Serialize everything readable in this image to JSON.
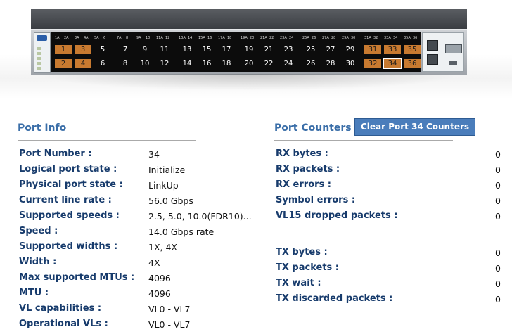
{
  "panel": {
    "port_labels": [
      "1A",
      "2A",
      "3A",
      "4A",
      "5A",
      "6",
      "7A",
      "8",
      "9A",
      "10",
      "11A",
      "12",
      "13A",
      "14",
      "15A",
      "16",
      "17A",
      "18",
      "19A",
      "20",
      "21A",
      "22",
      "23A",
      "24",
      "25A",
      "26",
      "27A",
      "28",
      "29A",
      "30",
      "31A",
      "32",
      "33A",
      "34",
      "35A",
      "36"
    ],
    "top_ports": [
      {
        "n": "1",
        "active": true
      },
      {
        "n": "3",
        "active": true
      },
      {
        "n": "5",
        "active": false
      },
      {
        "n": "7",
        "active": false
      },
      {
        "n": "9",
        "active": false
      },
      {
        "n": "11",
        "active": false
      },
      {
        "n": "13",
        "active": false
      },
      {
        "n": "15",
        "active": false
      },
      {
        "n": "17",
        "active": false
      },
      {
        "n": "19",
        "active": false
      },
      {
        "n": "21",
        "active": false
      },
      {
        "n": "23",
        "active": false
      },
      {
        "n": "25",
        "active": false
      },
      {
        "n": "27",
        "active": false
      },
      {
        "n": "29",
        "active": false
      },
      {
        "n": "31",
        "active": true
      },
      {
        "n": "33",
        "active": true
      },
      {
        "n": "35",
        "active": true
      }
    ],
    "bottom_ports": [
      {
        "n": "2",
        "active": true
      },
      {
        "n": "4",
        "active": true
      },
      {
        "n": "6",
        "active": false
      },
      {
        "n": "8",
        "active": false
      },
      {
        "n": "10",
        "active": false
      },
      {
        "n": "12",
        "active": false
      },
      {
        "n": "14",
        "active": false
      },
      {
        "n": "16",
        "active": false
      },
      {
        "n": "18",
        "active": false
      },
      {
        "n": "20",
        "active": false
      },
      {
        "n": "22",
        "active": false
      },
      {
        "n": "24",
        "active": false
      },
      {
        "n": "26",
        "active": false
      },
      {
        "n": "28",
        "active": false
      },
      {
        "n": "30",
        "active": false
      },
      {
        "n": "32",
        "active": true
      },
      {
        "n": "34",
        "active": true,
        "selected": true
      },
      {
        "n": "36",
        "active": true
      }
    ],
    "colors": {
      "active_port": "#c87a30",
      "inactive_port": "#0c0c0c",
      "chassis": "#b8bcc1"
    }
  },
  "port_info": {
    "title": "Port Info",
    "rows": [
      {
        "label": "Port Number :",
        "value": "34"
      },
      {
        "label": "Logical port state :",
        "value": "Initialize"
      },
      {
        "label": "Physical port state :",
        "value": "LinkUp"
      },
      {
        "label": "Current line rate :",
        "value": "56.0 Gbps"
      },
      {
        "label": "Supported speeds :",
        "value": "2.5, 5.0, 10.0(FDR10)..."
      },
      {
        "label": "Speed :",
        "value": "14.0 Gbps rate"
      },
      {
        "label": "Supported widths :",
        "value": "1X, 4X"
      },
      {
        "label": "Width :",
        "value": "4X"
      },
      {
        "label": "Max supported MTUs :",
        "value": "4096"
      },
      {
        "label": "MTU :",
        "value": "4096"
      },
      {
        "label": "VL capabilities :",
        "value": "VL0 - VL7"
      },
      {
        "label": "Operational VLs :",
        "value": "VL0 - VL7"
      }
    ]
  },
  "port_counters": {
    "title": "Port Counters",
    "clear_button": "Clear Port 34 Counters",
    "rx": [
      {
        "label": "RX bytes :",
        "value": "0"
      },
      {
        "label": "RX packets :",
        "value": "0"
      },
      {
        "label": "RX errors :",
        "value": "0"
      },
      {
        "label": "Symbol errors :",
        "value": "0"
      },
      {
        "label": "VL15 dropped packets :",
        "value": "0"
      }
    ],
    "tx": [
      {
        "label": "TX bytes :",
        "value": "0"
      },
      {
        "label": "TX packets :",
        "value": "0"
      },
      {
        "label": "TX wait :",
        "value": "0"
      },
      {
        "label": "TX discarded packets :",
        "value": "0"
      }
    ]
  },
  "theme": {
    "heading": "#3a6ea8",
    "label": "#173b6c",
    "button_bg": "#4a7dbb"
  }
}
